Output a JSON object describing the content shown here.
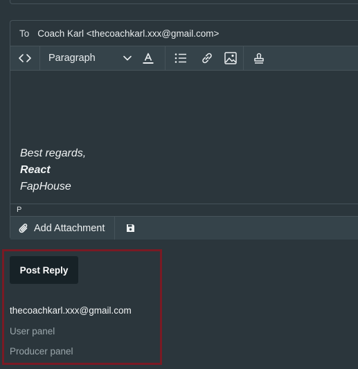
{
  "email": {
    "to_label": "To",
    "to_value": "Coach Karl <thecoachkarl.xxx@gmail.com>"
  },
  "toolbar": {
    "format_value": "Paragraph",
    "icons": [
      "code-icon",
      "chevron-down-icon",
      "text-color-icon",
      "bullet-list-icon",
      "link-icon",
      "image-icon",
      "stamp-icon"
    ]
  },
  "editor": {
    "line1": "Best regards,",
    "line2": "React",
    "line3": "FapHouse",
    "path": "P"
  },
  "attachments": {
    "add_label": "Add Attachment"
  },
  "actions": {
    "post_reply_label": "Post Reply"
  },
  "account": {
    "email": "thecoachkarl.xxx@gmail.com",
    "user_panel": "User panel",
    "producer_panel": "Producer panel"
  },
  "colors": {
    "background": "#2b363c",
    "toolbar": "#35434a",
    "button_dark": "#172227",
    "highlight": "#7a1a24",
    "muted_link": "#9aa6ab"
  }
}
